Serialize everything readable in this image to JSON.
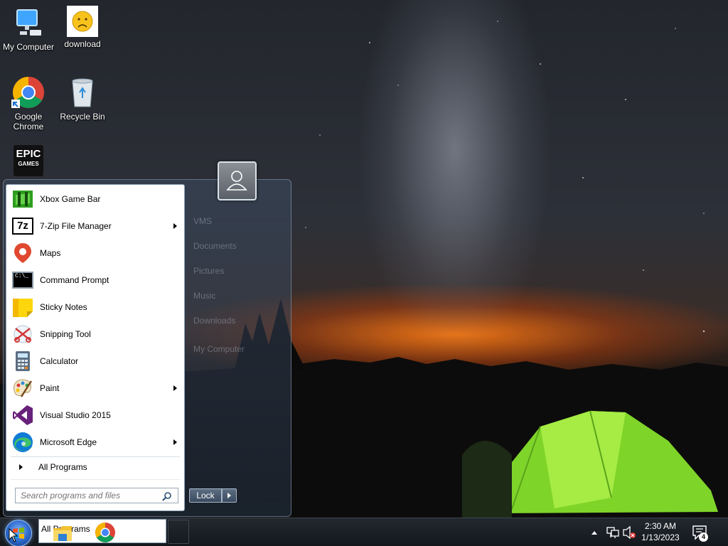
{
  "desktop": {
    "icons": [
      {
        "label": "My Computer"
      },
      {
        "label": "download"
      },
      {
        "label_line1": "Google",
        "label_line2": "Chrome"
      },
      {
        "label": "Recycle Bin"
      },
      {
        "label_line1": "EPIC",
        "label_line2": "GAMES"
      }
    ]
  },
  "start_menu": {
    "programs": [
      {
        "label": "Xbox Game Bar",
        "icon": "xbox-game-bar-icon",
        "submenu": false
      },
      {
        "label": "7-Zip File Manager",
        "icon": "seven-zip-icon",
        "badge": "7z",
        "submenu": true
      },
      {
        "label": "Maps",
        "icon": "maps-icon",
        "submenu": false
      },
      {
        "label": "Command Prompt",
        "icon": "command-prompt-icon",
        "badge": "C:\\_",
        "submenu": false
      },
      {
        "label": "Sticky Notes",
        "icon": "sticky-notes-icon",
        "submenu": false
      },
      {
        "label": "Snipping Tool",
        "icon": "snipping-tool-icon",
        "submenu": false
      },
      {
        "label": "Calculator",
        "icon": "calculator-icon",
        "submenu": false
      },
      {
        "label": "Paint",
        "icon": "paint-icon",
        "submenu": true
      },
      {
        "label": "Visual Studio 2015",
        "icon": "visual-studio-icon",
        "submenu": false
      },
      {
        "label": "Microsoft Edge",
        "icon": "edge-icon",
        "submenu": true
      }
    ],
    "all_programs_label": "All Programs",
    "search_placeholder": "Search programs and files",
    "right_items": [
      "VMS",
      "Documents",
      "Pictures",
      "Music",
      "Downloads",
      "My Computer"
    ],
    "lock_label": "Lock"
  },
  "taskbar": {
    "window_label": "All Programs",
    "clock_time": "2:30 AM",
    "clock_date": "1/13/2023",
    "notification_count": "4"
  }
}
